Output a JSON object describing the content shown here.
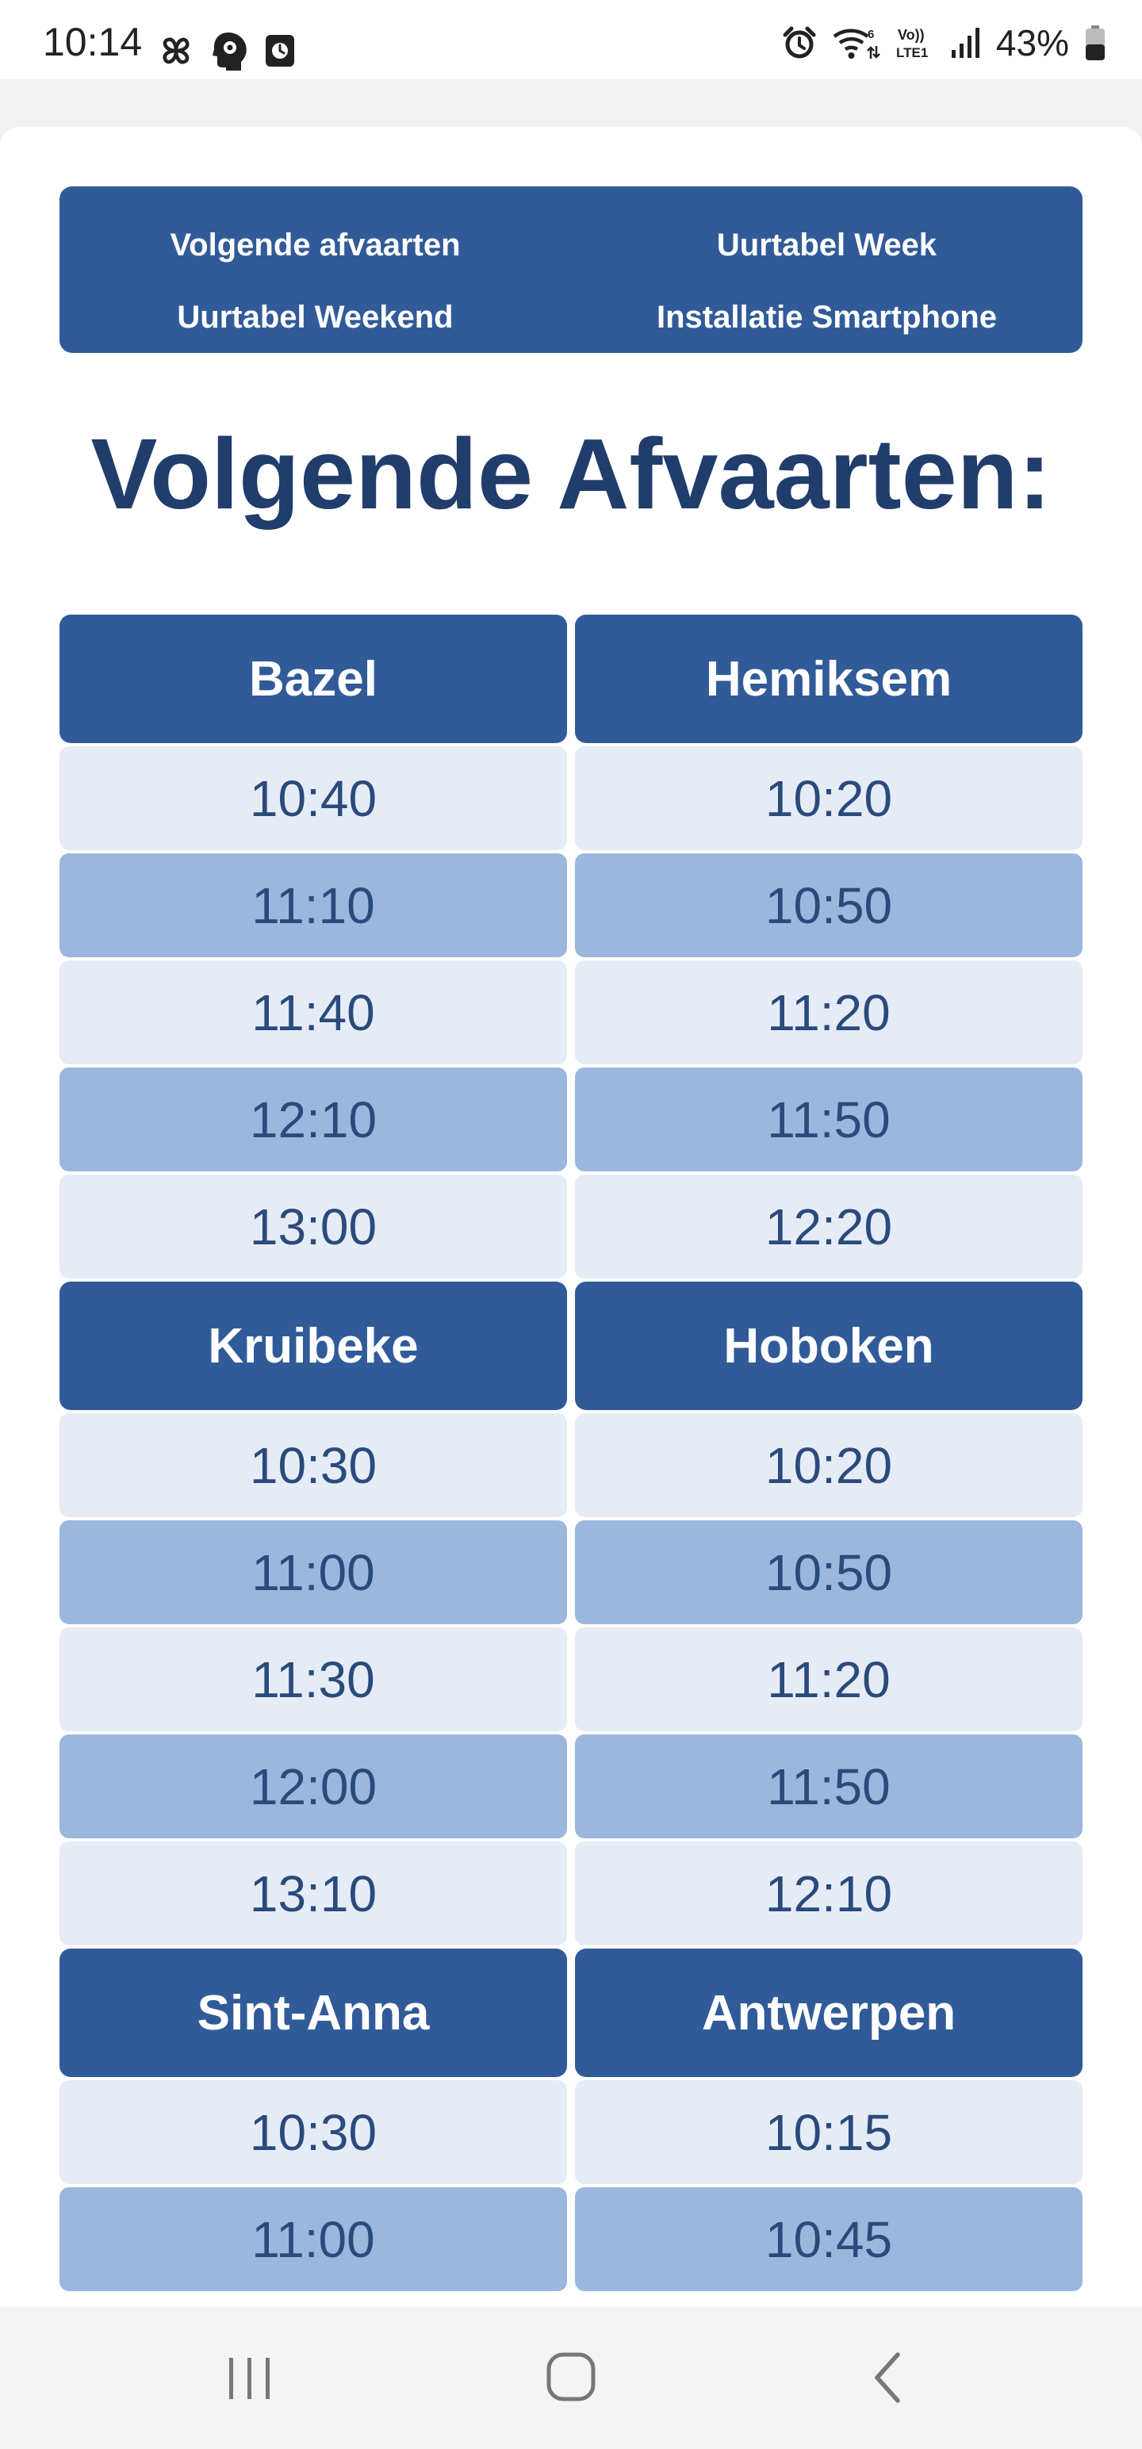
{
  "status_bar": {
    "time": "10:14",
    "battery_percent": "43%",
    "left_icons": [
      "pinwheel-icon",
      "head-gear-icon",
      "clock-app-icon"
    ],
    "right_icons": [
      "alarm-icon",
      "wifi-6-icon",
      "volte-lte1-icon",
      "signal-icon",
      "battery-icon"
    ]
  },
  "nav": {
    "links": [
      {
        "label": "Volgende afvaarten"
      },
      {
        "label": "Uurtabel Week"
      },
      {
        "label": "Uurtabel Weekend"
      },
      {
        "label": "Installatie Smartphone"
      }
    ]
  },
  "page_title": "Volgende Afvaarten:",
  "stations": [
    {
      "name": "Bazel",
      "times": [
        "10:40",
        "11:10",
        "11:40",
        "12:10",
        "13:00"
      ]
    },
    {
      "name": "Hemiksem",
      "times": [
        "10:20",
        "10:50",
        "11:20",
        "11:50",
        "12:20"
      ]
    },
    {
      "name": "Kruibeke",
      "times": [
        "10:30",
        "11:00",
        "11:30",
        "12:00",
        "13:10"
      ]
    },
    {
      "name": "Hoboken",
      "times": [
        "10:20",
        "10:50",
        "11:20",
        "11:50",
        "12:10"
      ]
    },
    {
      "name": "Sint-Anna",
      "times": [
        "10:30",
        "11:00"
      ]
    },
    {
      "name": "Antwerpen",
      "times": [
        "10:15",
        "10:45"
      ]
    }
  ],
  "system_nav": {
    "buttons": [
      "recent-apps-icon",
      "home-icon",
      "back-icon"
    ]
  },
  "colors": {
    "header_blue": "#315b98",
    "title_blue": "#203d6c",
    "row_light": "#e5ecf6",
    "row_dark": "#9cb7dd",
    "time_text": "#2b4a7c"
  }
}
